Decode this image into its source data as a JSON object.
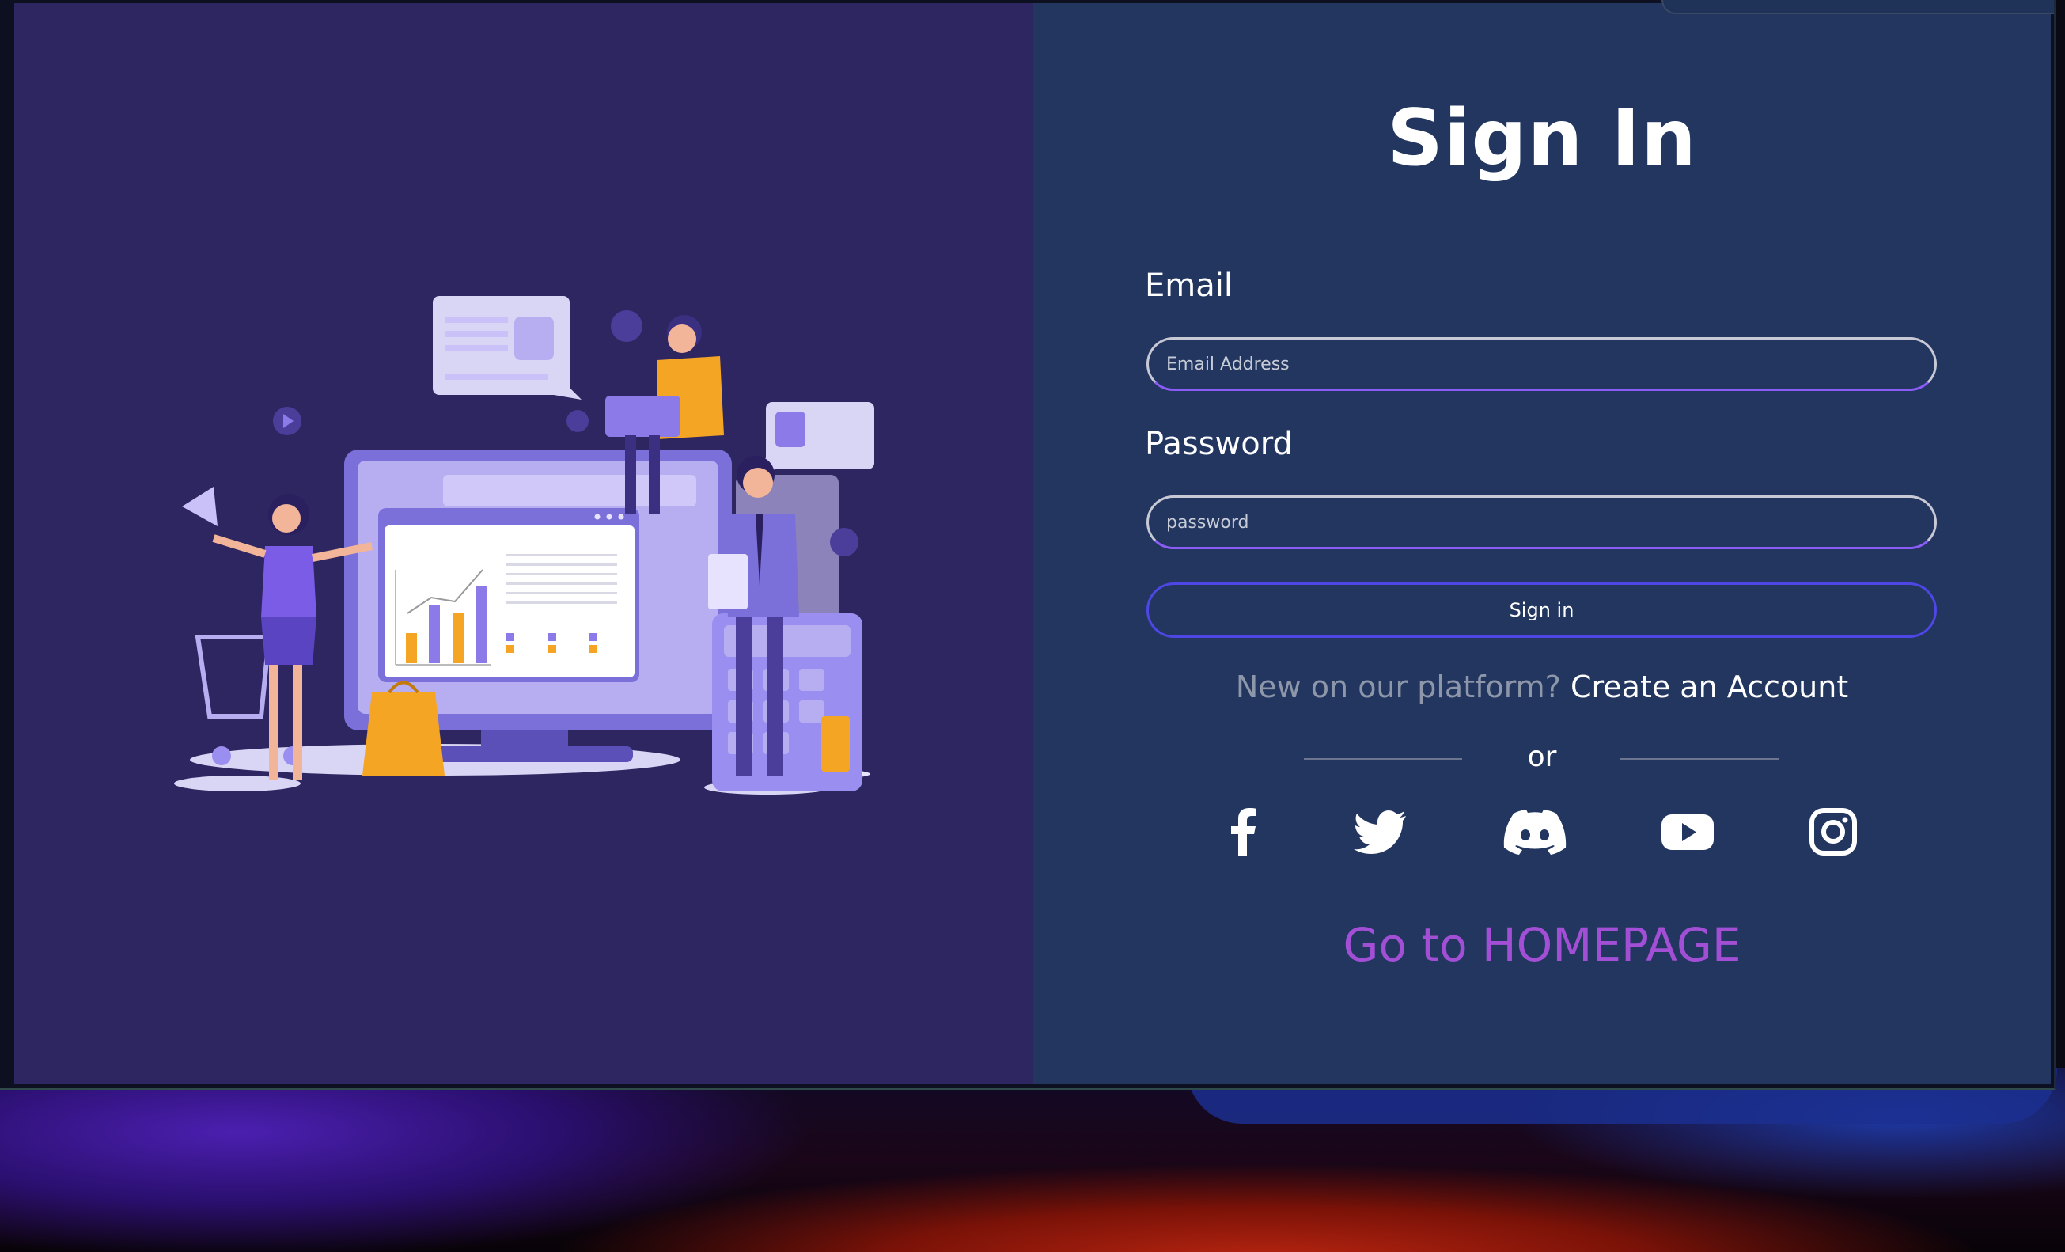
{
  "form": {
    "title": "Sign In",
    "email_label": "Email",
    "email_placeholder": "Email Address",
    "password_label": "Password",
    "password_placeholder": "password",
    "submit_label": "Sign in",
    "signup_prompt": "New on our platform?",
    "signup_link": "Create an Account",
    "divider_text": "or",
    "homepage_link": "Go to HOMEPAGE"
  },
  "social": [
    {
      "name": "facebook-icon"
    },
    {
      "name": "twitter-icon"
    },
    {
      "name": "discord-icon"
    },
    {
      "name": "youtube-icon"
    },
    {
      "name": "instagram-icon"
    }
  ],
  "colors": {
    "left_panel": "#2e2660",
    "right_panel": "#223660",
    "accent_purple": "#a24fd6",
    "button_border": "#4e46e5"
  }
}
